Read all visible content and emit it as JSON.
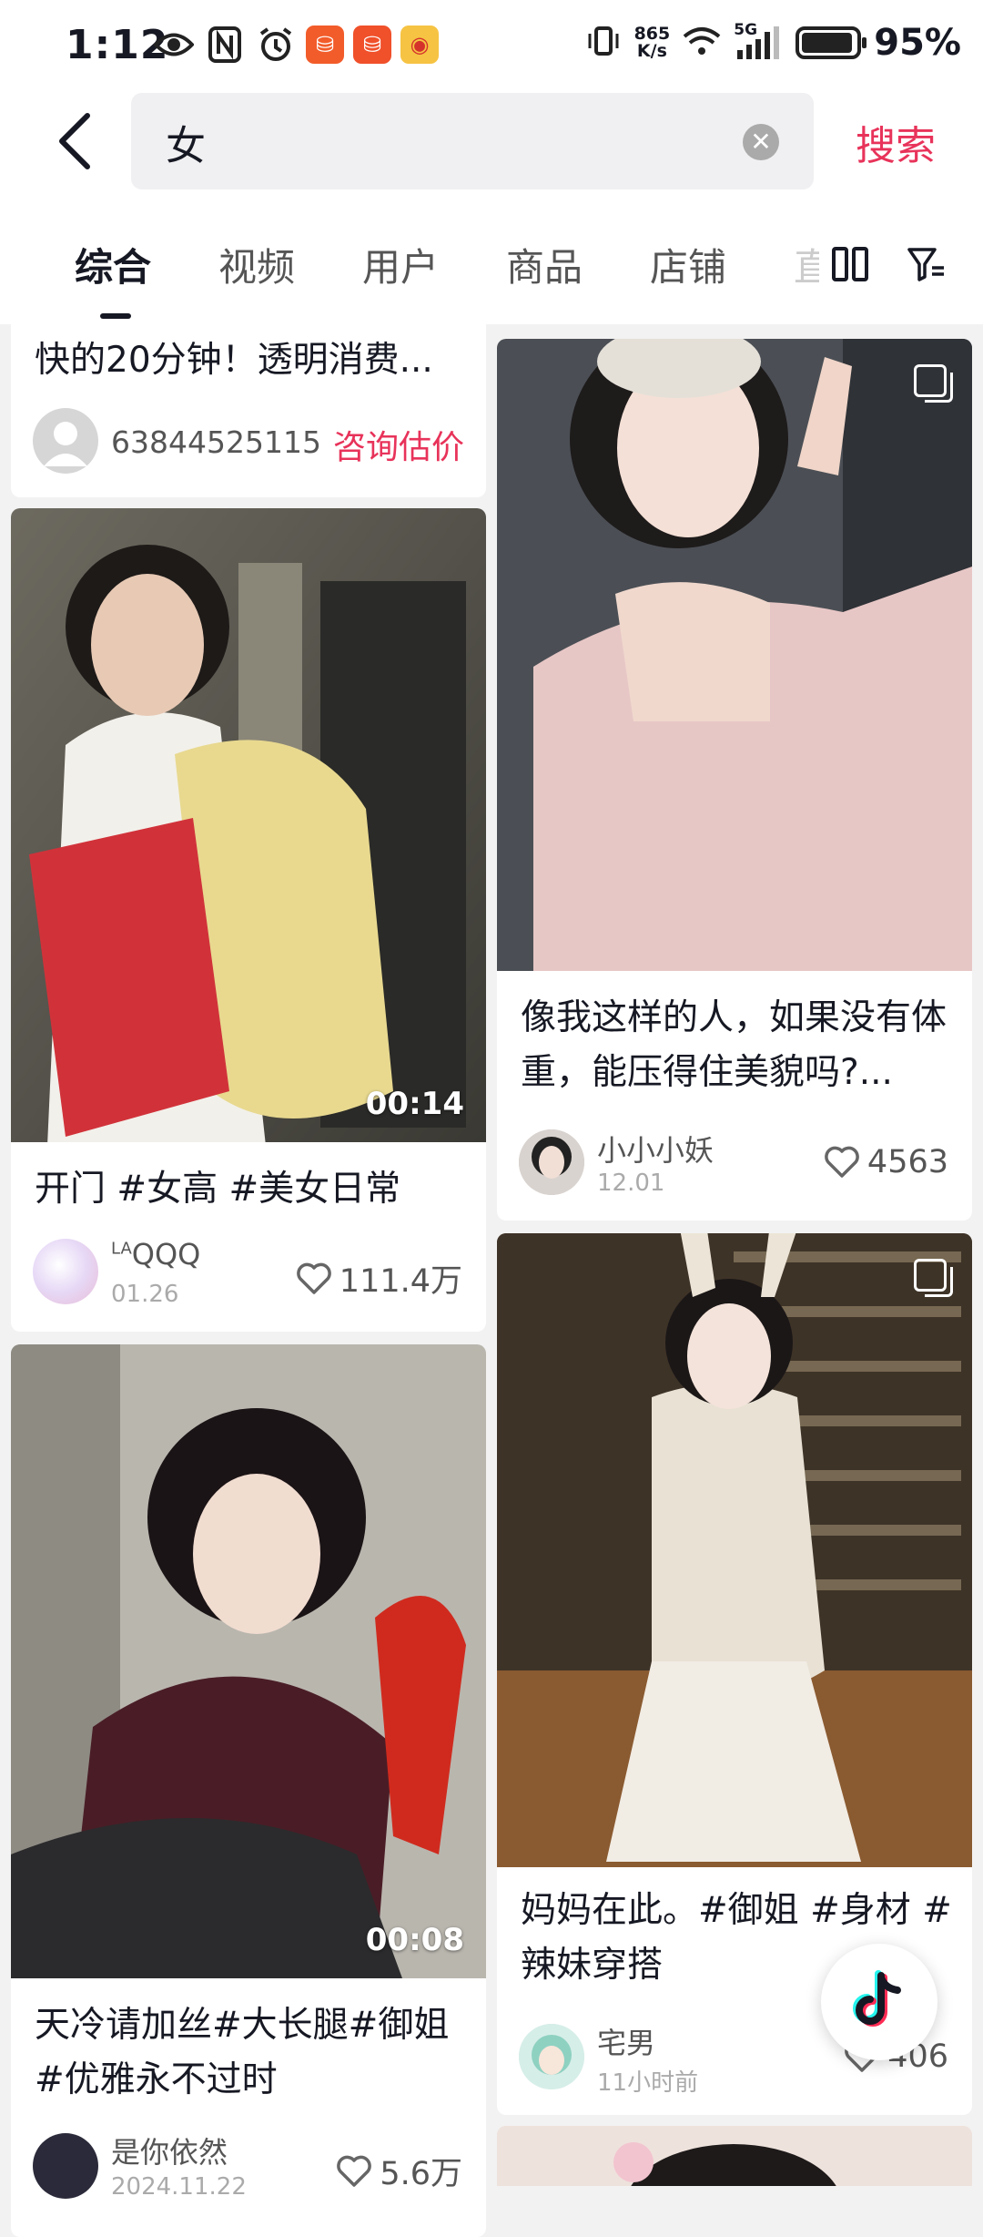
{
  "status_bar": {
    "time": "1:12",
    "net_speed_value": "865",
    "net_speed_unit": "K/s",
    "network": "5G",
    "battery_percent": "95%",
    "battery_level": 0.95
  },
  "search": {
    "query": "女",
    "submit_label": "搜索"
  },
  "tabs": {
    "items": [
      "综合",
      "视频",
      "用户",
      "商品",
      "店铺"
    ],
    "partial": "直",
    "active_index": 0
  },
  "feed": {
    "top_card": {
      "title": "快的20分钟！透明消费...",
      "author": "63844525115",
      "action": "咨询估价"
    },
    "left": [
      {
        "title": "开门 #女高 #美女日常",
        "duration": "00:14",
        "author_super": "LA",
        "author": "QQQ",
        "date": "01.26",
        "likes": "111.4万"
      },
      {
        "title": "天冷请加丝#大长腿#御姐#优雅永不过时",
        "duration": "00:08",
        "author": "是你依然",
        "date": "2024.11.22",
        "likes": "5.6万"
      }
    ],
    "right": [
      {
        "title": "像我这样的人，如果没有体重，能压得住美貌吗?...",
        "author": "小小小妖",
        "date": "12.01",
        "likes": "4563"
      },
      {
        "title": "妈妈在此。#御姐 #身材 #辣妹穿搭",
        "author": "宅男",
        "date": "11小时前",
        "likes": "406"
      }
    ]
  },
  "colors": {
    "accent": "#e8335a",
    "text_primary": "#161823",
    "background": "#f2f2f2"
  },
  "icons": [
    "back-arrow-icon",
    "clear-icon",
    "layout-toggle-icon",
    "filter-icon",
    "heart-icon",
    "multi-image-icon",
    "douyin-logo-icon"
  ]
}
